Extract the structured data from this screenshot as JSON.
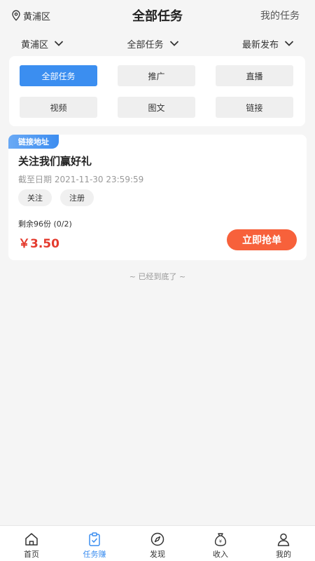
{
  "header": {
    "location": "黄浦区",
    "title": "全部任务",
    "my_tasks": "我的任务"
  },
  "filters": [
    {
      "label": "黄浦区"
    },
    {
      "label": "全部任务"
    },
    {
      "label": "最新发布"
    }
  ],
  "categories": [
    {
      "label": "全部任务",
      "active": true
    },
    {
      "label": "推广",
      "active": false
    },
    {
      "label": "直播",
      "active": false
    },
    {
      "label": "视频",
      "active": false
    },
    {
      "label": "图文",
      "active": false
    },
    {
      "label": "链接",
      "active": false
    }
  ],
  "task": {
    "tag": "链接地址",
    "title": "关注我们赢好礼",
    "deadline": "截至日期 2021-11-30 23:59:59",
    "chips": [
      "关注",
      "注册"
    ],
    "remaining": "剩余96份 (0/2)",
    "price": "￥3.50",
    "action": "立即抢单"
  },
  "end_text": "~ 已经到底了 ~",
  "tabbar": [
    {
      "label": "首页",
      "icon": "home-icon",
      "active": false
    },
    {
      "label": "任务赚",
      "icon": "clipboard-icon",
      "active": true
    },
    {
      "label": "发现",
      "icon": "compass-icon",
      "active": false
    },
    {
      "label": "收入",
      "icon": "money-bag-icon",
      "active": false
    },
    {
      "label": "我的",
      "icon": "user-icon",
      "active": false
    }
  ],
  "colors": {
    "accent": "#3b8ef0",
    "price": "#e43b2e",
    "action": "#f7613b"
  }
}
